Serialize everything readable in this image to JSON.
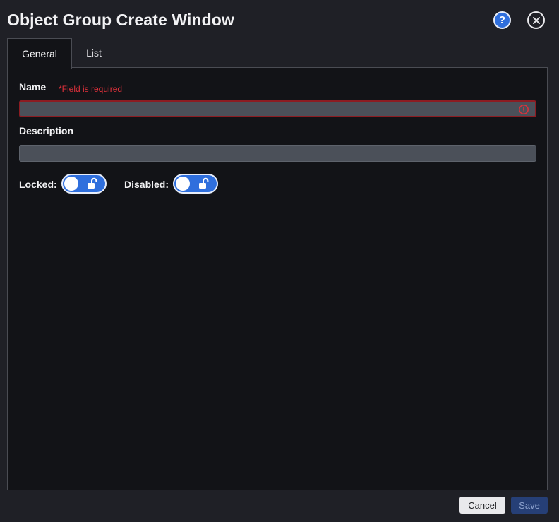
{
  "window": {
    "title": "Object Group Create Window"
  },
  "header": {
    "help_icon": "question-mark-icon",
    "close_icon": "close-x-icon",
    "help_glyph": "?"
  },
  "tabs": [
    {
      "label": "General",
      "active": true
    },
    {
      "label": "List",
      "active": false
    }
  ],
  "form": {
    "name_label": "Name",
    "name_error": "*Field is required",
    "name_value": "",
    "name_error_icon": "exclamation-circle-icon",
    "description_label": "Description",
    "description_value": "",
    "locked_label": "Locked:",
    "locked_state": "unlocked",
    "disabled_label": "Disabled:",
    "disabled_state": "unlocked"
  },
  "footer": {
    "cancel_label": "Cancel",
    "save_label": "Save"
  },
  "colors": {
    "background": "#1f2026",
    "panel": "#121317",
    "accent": "#2f6fdd",
    "error": "#e0313b",
    "input": "#4b5059"
  }
}
